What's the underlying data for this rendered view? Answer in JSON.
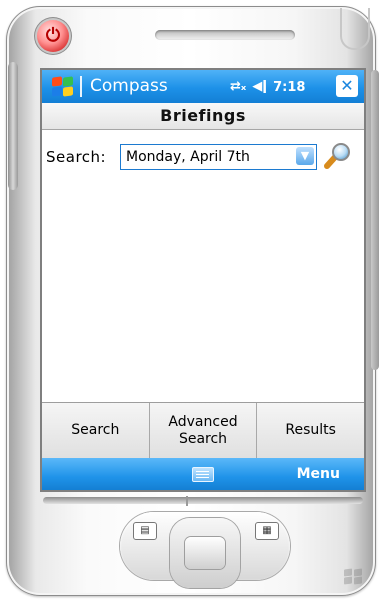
{
  "app": {
    "title": "Compass",
    "time": "7:18",
    "close_label": "✕"
  },
  "page": {
    "header": "Briefings"
  },
  "search": {
    "label": "Search:",
    "selected_value": "Monday, April 7th"
  },
  "toolbar": {
    "buttons": [
      {
        "label": "Search"
      },
      {
        "label": "Advanced Search"
      },
      {
        "label": "Results"
      }
    ]
  },
  "softkeys": {
    "right": "Menu"
  },
  "colors": {
    "accent": "#1d91e8",
    "power": "#d83030"
  },
  "icons": {
    "start": "windows-flag-icon",
    "connectivity": "connectivity-icon",
    "volume": "speaker-icon",
    "go": "magnifier-icon",
    "keyboard": "keyboard-icon"
  }
}
